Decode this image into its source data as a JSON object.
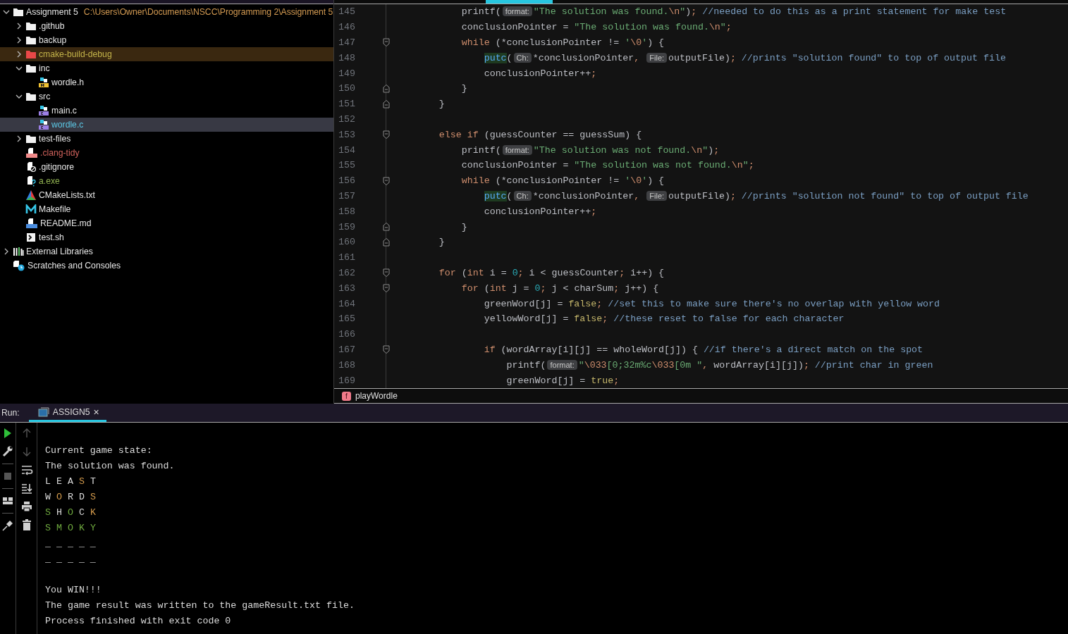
{
  "project_tree": {
    "items": [
      {
        "label": "Assignment 5",
        "path": "C:\\Users\\Owner\\Documents\\NSCC\\Programming 2\\Assignment 5",
        "kind": "folder",
        "expanded": true,
        "selected": false,
        "excluded": false,
        "children": [
          {
            "label": ".github",
            "kind": "folder",
            "expanded": false,
            "selected": false,
            "excluded": false
          },
          {
            "label": "backup",
            "kind": "folder",
            "expanded": false,
            "selected": false,
            "excluded": false
          },
          {
            "label": "cmake-build-debug",
            "kind": "folder",
            "expanded": false,
            "selected": false,
            "excluded": true,
            "color": "#c4b44a"
          },
          {
            "label": "inc",
            "kind": "folder",
            "expanded": true,
            "selected": false,
            "excluded": false,
            "children": [
              {
                "label": "wordle.h",
                "kind": "header",
                "selected": false,
                "excluded": false
              }
            ]
          },
          {
            "label": "src",
            "kind": "folder",
            "expanded": true,
            "selected": false,
            "excluded": false,
            "children": [
              {
                "label": "main.c",
                "kind": "c-source",
                "selected": false,
                "excluded": false
              },
              {
                "label": "wordle.c",
                "kind": "c-source",
                "selected": true,
                "excluded": false,
                "color": "#5cc8e6"
              }
            ]
          },
          {
            "label": "test-files",
            "kind": "folder",
            "expanded": false,
            "selected": false,
            "excluded": false
          },
          {
            "label": ".clang-tidy",
            "kind": "yaml",
            "selected": false,
            "excluded": false,
            "color": "#d0625c"
          },
          {
            "label": ".gitignore",
            "kind": "gitignore",
            "selected": false,
            "excluded": false
          },
          {
            "label": "a.exe",
            "kind": "unknown",
            "selected": false,
            "excluded": false,
            "color": "#93b552"
          },
          {
            "label": "CMakeLists.txt",
            "kind": "cmake",
            "selected": false,
            "excluded": false
          },
          {
            "label": "Makefile",
            "kind": "makefile",
            "selected": false,
            "excluded": false
          },
          {
            "label": "README.md",
            "kind": "markdown",
            "selected": false,
            "excluded": false
          },
          {
            "label": "test.sh",
            "kind": "shell",
            "selected": false,
            "excluded": false
          }
        ]
      },
      {
        "label": "External Libraries",
        "kind": "libraries",
        "expanded": false,
        "selected": false,
        "excluded": false
      },
      {
        "label": "Scratches and Consoles",
        "kind": "scratches",
        "selected": false,
        "excluded": false
      }
    ]
  },
  "editor": {
    "lines": [
      {
        "number": "145",
        "fold_start": false,
        "fold_end": false,
        "tokens": [
          {
            "kind": "plain",
            "text": "            printf("
          },
          {
            "kind": "hint",
            "text": "format:"
          },
          {
            "kind": "string",
            "text": "\"The solution was found."
          },
          {
            "kind": "escape",
            "text": "\\n"
          },
          {
            "kind": "string",
            "text": "\""
          },
          {
            "kind": "plain",
            "text": ")"
          },
          {
            "kind": "punct",
            "text": ";"
          },
          {
            "kind": "comment",
            "text": " //needed to do this as a print statement for make test"
          }
        ]
      },
      {
        "number": "146",
        "fold_start": false,
        "fold_end": false,
        "tokens": [
          {
            "kind": "plain",
            "text": "            conclusionPointer = "
          },
          {
            "kind": "string",
            "text": "\"The solution was found."
          },
          {
            "kind": "escape",
            "text": "\\n"
          },
          {
            "kind": "string",
            "text": "\""
          },
          {
            "kind": "punct",
            "text": ";"
          }
        ]
      },
      {
        "number": "147",
        "fold_start": true,
        "fold_end": false,
        "tokens": [
          {
            "kind": "keyword",
            "text": "            while"
          },
          {
            "kind": "plain",
            "text": " (*conclusionPointer != "
          },
          {
            "kind": "string",
            "text": "'"
          },
          {
            "kind": "escape",
            "text": "\\0"
          },
          {
            "kind": "string",
            "text": "'"
          },
          {
            "kind": "plain",
            "text": ") {"
          }
        ]
      },
      {
        "number": "148",
        "fold_start": false,
        "fold_end": false,
        "tokens": [
          {
            "kind": "call",
            "text": "                putc"
          },
          {
            "kind": "plain",
            "text": "("
          },
          {
            "kind": "hint",
            "text": "Ch:"
          },
          {
            "kind": "plain",
            "text": "*conclusionPointer"
          },
          {
            "kind": "punct",
            "text": ", "
          },
          {
            "kind": "hint",
            "text": "File:"
          },
          {
            "kind": "plain",
            "text": "outputFile)"
          },
          {
            "kind": "punct",
            "text": ";"
          },
          {
            "kind": "comment",
            "text": " //prints \"solution found\" to top of output file"
          }
        ]
      },
      {
        "number": "149",
        "fold_start": false,
        "fold_end": false,
        "tokens": [
          {
            "kind": "plain",
            "text": "                conclusionPointer++"
          },
          {
            "kind": "punct",
            "text": ";"
          }
        ]
      },
      {
        "number": "150",
        "fold_start": false,
        "fold_end": true,
        "tokens": [
          {
            "kind": "plain",
            "text": "            }"
          }
        ]
      },
      {
        "number": "151",
        "fold_start": false,
        "fold_end": true,
        "tokens": [
          {
            "kind": "plain",
            "text": "        }"
          }
        ]
      },
      {
        "number": "152",
        "fold_start": false,
        "fold_end": false
      },
      {
        "number": "153",
        "fold_start": true,
        "fold_end": false,
        "tokens": [
          {
            "kind": "keyword",
            "text": "        else if"
          },
          {
            "kind": "plain",
            "text": " (guessCounter == guessSum) {"
          }
        ]
      },
      {
        "number": "154",
        "fold_start": false,
        "fold_end": false,
        "tokens": [
          {
            "kind": "plain",
            "text": "            printf("
          },
          {
            "kind": "hint",
            "text": "format:"
          },
          {
            "kind": "string",
            "text": "\"The solution was not found."
          },
          {
            "kind": "escape",
            "text": "\\n"
          },
          {
            "kind": "string",
            "text": "\""
          },
          {
            "kind": "plain",
            "text": ")"
          },
          {
            "kind": "punct",
            "text": ";"
          }
        ]
      },
      {
        "number": "155",
        "fold_start": false,
        "fold_end": false,
        "tokens": [
          {
            "kind": "plain",
            "text": "            conclusionPointer = "
          },
          {
            "kind": "string",
            "text": "\"The solution was not found."
          },
          {
            "kind": "escape",
            "text": "\\n"
          },
          {
            "kind": "string",
            "text": "\""
          },
          {
            "kind": "punct",
            "text": ";"
          }
        ]
      },
      {
        "number": "156",
        "fold_start": true,
        "fold_end": false,
        "tokens": [
          {
            "kind": "keyword",
            "text": "            while"
          },
          {
            "kind": "plain",
            "text": " (*conclusionPointer != "
          },
          {
            "kind": "string",
            "text": "'"
          },
          {
            "kind": "escape",
            "text": "\\0"
          },
          {
            "kind": "string",
            "text": "'"
          },
          {
            "kind": "plain",
            "text": ") {"
          }
        ]
      },
      {
        "number": "157",
        "fold_start": false,
        "fold_end": false,
        "tokens": [
          {
            "kind": "call",
            "text": "                putc"
          },
          {
            "kind": "plain",
            "text": "("
          },
          {
            "kind": "hint",
            "text": "Ch:"
          },
          {
            "kind": "plain",
            "text": "*conclusionPointer"
          },
          {
            "kind": "punct",
            "text": ", "
          },
          {
            "kind": "hint",
            "text": "File:"
          },
          {
            "kind": "plain",
            "text": "outputFile)"
          },
          {
            "kind": "punct",
            "text": ";"
          },
          {
            "kind": "comment",
            "text": " //prints \"solution not found\" to top of output file"
          }
        ]
      },
      {
        "number": "158",
        "fold_start": false,
        "fold_end": false,
        "tokens": [
          {
            "kind": "plain",
            "text": "                conclusionPointer++"
          },
          {
            "kind": "punct",
            "text": ";"
          }
        ]
      },
      {
        "number": "159",
        "fold_start": false,
        "fold_end": true,
        "tokens": [
          {
            "kind": "plain",
            "text": "            }"
          }
        ]
      },
      {
        "number": "160",
        "fold_start": false,
        "fold_end": true,
        "tokens": [
          {
            "kind": "plain",
            "text": "        }"
          }
        ]
      },
      {
        "number": "161",
        "fold_start": false,
        "fold_end": false
      },
      {
        "number": "162",
        "fold_start": true,
        "fold_end": false,
        "tokens": [
          {
            "kind": "keyword",
            "text": "        for"
          },
          {
            "kind": "plain",
            "text": " ("
          },
          {
            "kind": "keyword",
            "text": "int"
          },
          {
            "kind": "plain",
            "text": " i = "
          },
          {
            "kind": "number",
            "text": "0"
          },
          {
            "kind": "punct",
            "text": ";"
          },
          {
            "kind": "plain",
            "text": " i < guessCounter"
          },
          {
            "kind": "punct",
            "text": ";"
          },
          {
            "kind": "plain",
            "text": " i++) {"
          }
        ]
      },
      {
        "number": "163",
        "fold_start": true,
        "fold_end": false,
        "tokens": [
          {
            "kind": "keyword",
            "text": "            for"
          },
          {
            "kind": "plain",
            "text": " ("
          },
          {
            "kind": "keyword",
            "text": "int"
          },
          {
            "kind": "plain",
            "text": " j = "
          },
          {
            "kind": "number",
            "text": "0"
          },
          {
            "kind": "punct",
            "text": ";"
          },
          {
            "kind": "plain",
            "text": " j < charSum"
          },
          {
            "kind": "punct",
            "text": ";"
          },
          {
            "kind": "plain",
            "text": " j++) {"
          }
        ]
      },
      {
        "number": "164",
        "fold_start": false,
        "fold_end": false,
        "tokens": [
          {
            "kind": "plain",
            "text": "                greenWord[j] = "
          },
          {
            "kind": "literal",
            "text": "false"
          },
          {
            "kind": "punct",
            "text": ";"
          },
          {
            "kind": "comment",
            "text": " //set this to make sure there's no overlap with yellow word"
          }
        ]
      },
      {
        "number": "165",
        "fold_start": false,
        "fold_end": false,
        "tokens": [
          {
            "kind": "plain",
            "text": "                yellowWord[j] = "
          },
          {
            "kind": "literal",
            "text": "false"
          },
          {
            "kind": "punct",
            "text": ";"
          },
          {
            "kind": "comment",
            "text": " //these reset to false for each character"
          }
        ]
      },
      {
        "number": "166",
        "fold_start": false,
        "fold_end": false
      },
      {
        "number": "167",
        "fold_start": true,
        "fold_end": false,
        "tokens": [
          {
            "kind": "keyword",
            "text": "                if"
          },
          {
            "kind": "plain",
            "text": " (wordArray[i][j] == wholeWord[j]) {"
          },
          {
            "kind": "comment",
            "text": " //if there's a direct match on the spot"
          }
        ]
      },
      {
        "number": "168",
        "fold_start": false,
        "fold_end": false,
        "tokens": [
          {
            "kind": "plain",
            "text": "                    printf("
          },
          {
            "kind": "hint",
            "text": "format:"
          },
          {
            "kind": "string",
            "text": "\""
          },
          {
            "kind": "escape",
            "text": "\\033"
          },
          {
            "kind": "string",
            "text": "[0;32m%c"
          },
          {
            "kind": "escape",
            "text": "\\033"
          },
          {
            "kind": "string",
            "text": "[0m \""
          },
          {
            "kind": "punct",
            "text": ","
          },
          {
            "kind": "plain",
            "text": " wordArray[i][j])"
          },
          {
            "kind": "punct",
            "text": ";"
          },
          {
            "kind": "comment",
            "text": " //print char in green"
          }
        ]
      },
      {
        "number": "169",
        "fold_start": false,
        "fold_end": false,
        "tokens": [
          {
            "kind": "plain",
            "text": "                    greenWord[j] = "
          },
          {
            "kind": "literal",
            "text": "true"
          },
          {
            "kind": "punct",
            "text": ";"
          }
        ]
      }
    ],
    "breadcrumb": {
      "badge": "f",
      "label": "playWordle"
    }
  },
  "run_panel": {
    "label": "Run:",
    "tabs": [
      {
        "label": "ASSIGN5",
        "close": "×",
        "selected": true
      }
    ],
    "toolbar": [
      {
        "kind": "run",
        "disabled": false
      },
      {
        "kind": "settings",
        "disabled": false
      },
      {
        "kind": "separator"
      },
      {
        "kind": "stop",
        "disabled": true
      },
      {
        "kind": "separator"
      },
      {
        "kind": "layout",
        "disabled": false
      },
      {
        "kind": "separator"
      },
      {
        "kind": "pin",
        "disabled": false
      }
    ],
    "side_toolbar": [
      {
        "kind": "up",
        "disabled": true
      },
      {
        "kind": "down",
        "disabled": true
      },
      {
        "kind": "wrap",
        "disabled": false
      },
      {
        "kind": "scroll-end",
        "disabled": false
      },
      {
        "kind": "print",
        "disabled": false
      },
      {
        "kind": "trash",
        "disabled": false
      }
    ],
    "output": [
      {
        "kind": "text",
        "text": "Current game state:"
      },
      {
        "kind": "text",
        "text": "The solution was found."
      },
      {
        "kind": "letters",
        "letters": [
          {
            "char": "L",
            "color": "#dcdcdc"
          },
          {
            "char": "E",
            "color": "#dcdcdc"
          },
          {
            "char": "A",
            "color": "#dcdcdc"
          },
          {
            "char": "S",
            "color": "#d39a4c"
          },
          {
            "char": "T",
            "color": "#dcdcdc"
          }
        ]
      },
      {
        "kind": "letters",
        "letters": [
          {
            "char": "W",
            "color": "#dcdcdc"
          },
          {
            "char": "O",
            "color": "#d39a4c"
          },
          {
            "char": "R",
            "color": "#dcdcdc"
          },
          {
            "char": "D",
            "color": "#dcdcdc"
          },
          {
            "char": "S",
            "color": "#d39a4c"
          }
        ]
      },
      {
        "kind": "letters",
        "letters": [
          {
            "char": "S",
            "color": "#6ea83e"
          },
          {
            "char": "H",
            "color": "#dcdcdc"
          },
          {
            "char": "O",
            "color": "#6ea83e"
          },
          {
            "char": "C",
            "color": "#dcdcdc"
          },
          {
            "char": "K",
            "color": "#d39a4c"
          }
        ]
      },
      {
        "kind": "letters",
        "letters": [
          {
            "char": "S",
            "color": "#6ea83e"
          },
          {
            "char": "M",
            "color": "#6ea83e"
          },
          {
            "char": "O",
            "color": "#6ea83e"
          },
          {
            "char": "K",
            "color": "#6ea83e"
          },
          {
            "char": "Y",
            "color": "#6ea83e"
          }
        ]
      },
      {
        "kind": "text",
        "text": "_ _ _ _ _"
      },
      {
        "kind": "text",
        "text": "_ _ _ _ _"
      },
      {
        "kind": "blank"
      },
      {
        "kind": "text",
        "text": "You WIN!!!"
      },
      {
        "kind": "text",
        "text": "The game result was written to the gameResult.txt file."
      },
      {
        "kind": "text",
        "text": "Process finished with exit code 0"
      }
    ]
  }
}
